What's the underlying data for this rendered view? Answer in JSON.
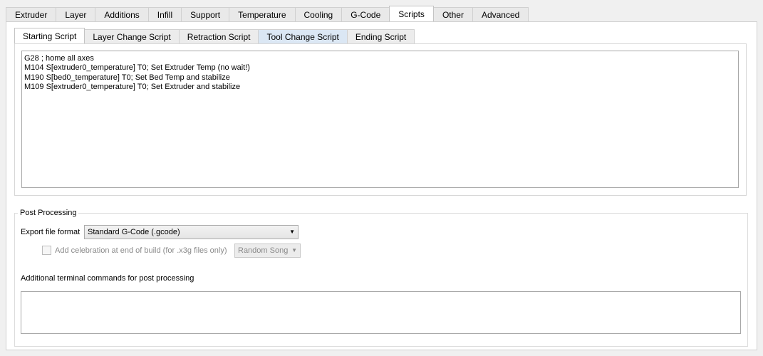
{
  "main_tabs": [
    "Extruder",
    "Layer",
    "Additions",
    "Infill",
    "Support",
    "Temperature",
    "Cooling",
    "G-Code",
    "Scripts",
    "Other",
    "Advanced"
  ],
  "active_main_tab": "Scripts",
  "script_tabs": [
    "Starting Script",
    "Layer Change Script",
    "Retraction Script",
    "Tool Change Script",
    "Ending Script"
  ],
  "active_script_tab": "Starting Script",
  "starting_script": [
    "G28 ; home all axes",
    "M104 S[extruder0_temperature] T0; Set Extruder Temp (no wait!)",
    "M190 S[bed0_temperature] T0; Set Bed Temp and stabilize",
    "M109 S[extruder0_temperature] T0; Set Extruder and stabilize"
  ],
  "post_processing": {
    "title": "Post Processing",
    "export_label": "Export file format",
    "export_value": "Standard G-Code (.gcode)",
    "celebration_label": "Add celebration at end of build (for .x3g files only)",
    "celebration_checked": false,
    "song_value": "Random Song",
    "terminal_label": "Additional terminal commands for post processing",
    "terminal_value": ""
  },
  "icons": {
    "dropdown": "chevron-down-icon"
  }
}
